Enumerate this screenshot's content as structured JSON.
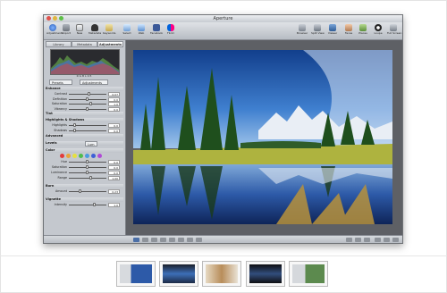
{
  "window": {
    "title": "Aperture"
  },
  "toolbar": {
    "left_buttons": [
      "Adjustments",
      "Import",
      "New",
      "Metadata",
      "Keywords"
    ],
    "right_buttons": [
      "Select",
      "Web",
      "Facebook",
      "Flickr",
      "Browser",
      "Split View",
      "Viewer",
      "Faces",
      "Places",
      "Loupe",
      "Full Screen"
    ]
  },
  "inspector": {
    "tabs": [
      "Library",
      "Metadata",
      "Adjustments"
    ],
    "histogram_info": "R G B  L  0.5",
    "presets_label": "Presets",
    "add_adjustment_label": "Adjustments",
    "sections": {
      "enhance": "Enhance",
      "tint": "Tint",
      "highlights_shadows": "Highlights & Shadows",
      "advanced": "Advanced",
      "levels": "Levels",
      "color": "Color",
      "edge_sharpen": "Burn",
      "vignette": "Vignette"
    },
    "enhance_rows": [
      {
        "name": "Contrast",
        "value": "0.07",
        "pos": 0.55
      },
      {
        "name": "Definition",
        "value": "0.0",
        "pos": 0.5
      },
      {
        "name": "Saturation",
        "value": "1.0",
        "pos": 0.6
      },
      {
        "name": "Vibrancy",
        "value": "0.0",
        "pos": 0.5
      }
    ],
    "highlights_rows": [
      {
        "name": "Highlights",
        "value": "0.0",
        "pos": 0.15
      },
      {
        "name": "Shadows",
        "value": "0.0",
        "pos": 0.15
      }
    ],
    "color_rows": [
      {
        "name": "Hue",
        "value": "0.0",
        "pos": 0.5
      },
      {
        "name": "Saturation",
        "value": "0.0",
        "pos": 0.5
      },
      {
        "name": "Luminance",
        "value": "0.0",
        "pos": 0.5
      },
      {
        "name": "Range",
        "value": "1.00",
        "pos": 0.6
      }
    ],
    "burn_rows": [
      {
        "name": "Amount",
        "value": "0.23",
        "pos": 0.3
      }
    ],
    "vignette_rows": [
      {
        "name": "Intensity",
        "value": "1.0",
        "pos": 0.7
      }
    ],
    "levels_options": [
      "Lum",
      "RGB"
    ]
  },
  "colors": {
    "swatches": [
      "#e23b3b",
      "#e8a53a",
      "#e6e03e",
      "#4dbb4d",
      "#4a9be0",
      "#3d5fd6",
      "#b04ad6"
    ]
  }
}
